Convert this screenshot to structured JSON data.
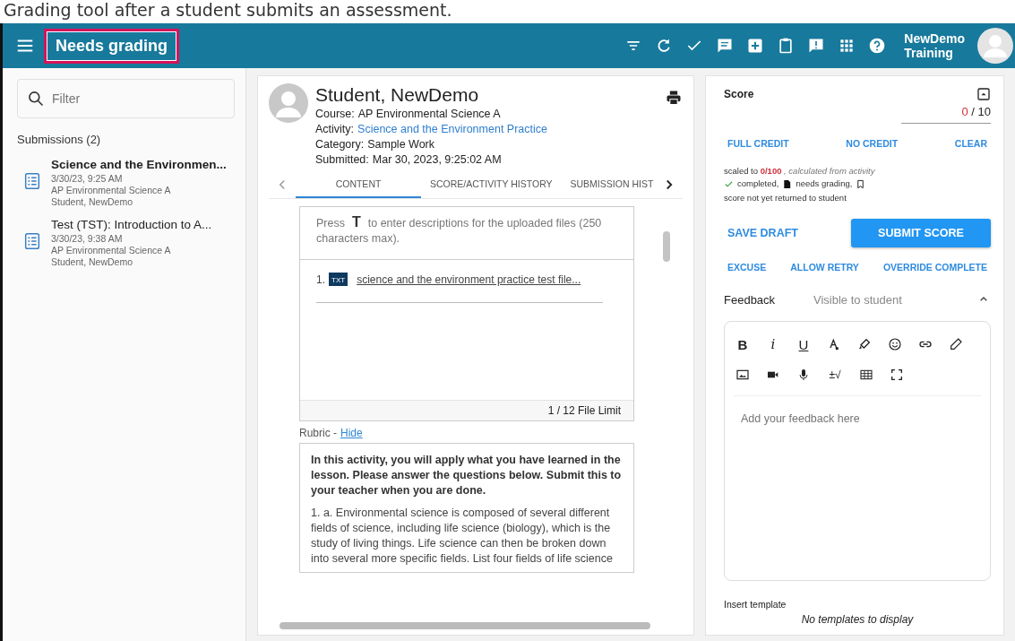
{
  "caption": "Grading tool after a student submits an assessment.",
  "header": {
    "title": "Needs grading",
    "title_highlighted": true,
    "user_line1": "NewDemo",
    "user_line2": "Training"
  },
  "sidebar": {
    "filter_placeholder": "Filter",
    "heading": "Submissions (2)",
    "items": [
      {
        "title": "Science and the Environmen...",
        "date": "3/30/23, 9:25 AM",
        "course": "AP Environmental Science A",
        "student": "Student, NewDemo"
      },
      {
        "title": "Test (TST): Introduction to A...",
        "date": "3/30/23, 9:38 AM",
        "course": "AP Environmental Science A",
        "student": "Student, NewDemo"
      }
    ]
  },
  "submission": {
    "name": "Student, NewDemo",
    "meta": [
      {
        "label": "Course:",
        "value": "AP Environmental Science A",
        "link": false
      },
      {
        "label": "Activity:",
        "value": "Science and the Environment Practice",
        "link": true
      },
      {
        "label": "Category:",
        "value": "Sample Work",
        "link": false
      },
      {
        "label": "Submitted:",
        "value": "Mar 30, 2023, 9:25:02 AM",
        "link": false
      }
    ],
    "tabs": [
      {
        "label": "CONTENT",
        "selected": true
      },
      {
        "label": "SCORE/ACTIVITY HISTORY",
        "selected": false
      },
      {
        "label": "SUBMISSION HIST",
        "selected": false
      }
    ],
    "hint_before": "Press",
    "hint_key": "T",
    "hint_after": "to enter descriptions for the uploaded files (250 characters max).",
    "files": [
      {
        "number": "1.",
        "type": "TXT",
        "name": "science and the environment practice test file..."
      }
    ],
    "file_limit": "1 / 12 File Limit",
    "rubric_label": "Rubric -",
    "rubric_toggle": "Hide",
    "rubric_intro": "In this activity, you will apply what you have learned in the lesson. Please answer the questions below. Submit this to your teacher when you are done.",
    "rubric_question": "1. a. Environmental science is composed of several different fields of science, including life science (biology), which is the study of living things. Life science can then be broken down into several more specific fields. List four fields of life science"
  },
  "score": {
    "title": "Score",
    "value": "0",
    "max": "/ 10",
    "quick_actions": [
      "FULL CREDIT",
      "NO CREDIT",
      "CLEAR"
    ],
    "scaled_prefix": "scaled to",
    "scaled_value": "0/100",
    "scaled_suffix": ", calculated from activity",
    "status": [
      {
        "kind": "check",
        "text": "completed,"
      },
      {
        "kind": "document",
        "text": "needs grading,"
      },
      {
        "kind": "bookmark",
        "text": "score not yet returned to student"
      }
    ],
    "save_draft": "SAVE DRAFT",
    "submit": "SUBMIT SCORE",
    "actions": [
      "EXCUSE",
      "ALLOW RETRY",
      "OVERRIDE COMPLETE"
    ]
  },
  "feedback": {
    "title": "Feedback",
    "visibility": "Visible to student",
    "expanded": true,
    "bold_key": "B",
    "italic_key": "i",
    "underline_key": "U",
    "math_key": "±√",
    "placeholder": "Add your feedback here",
    "template_label": "Insert template",
    "templates_empty": "No templates to display"
  }
}
